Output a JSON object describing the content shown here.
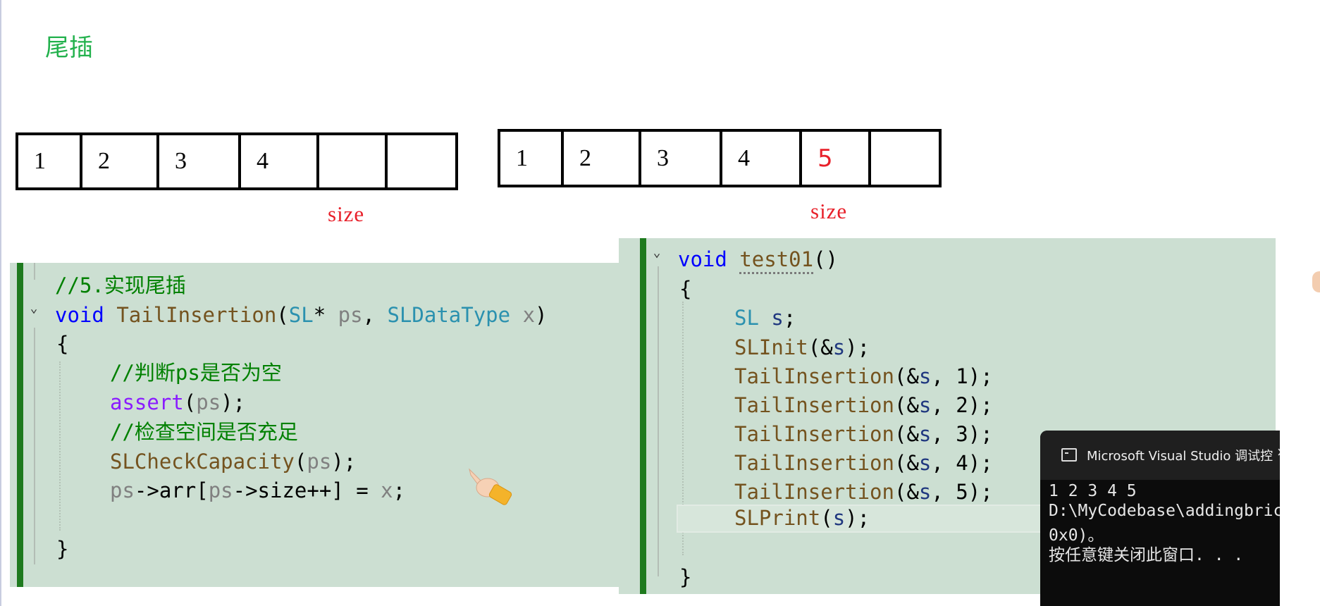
{
  "heading": "尾插",
  "array_before": {
    "cells": [
      "1",
      "2",
      "3",
      "4",
      "",
      ""
    ],
    "pointer_label": "size"
  },
  "array_after": {
    "cells": [
      "1",
      "2",
      "3",
      "4",
      "5",
      ""
    ],
    "pointer_label": "size",
    "highlight_value": "5",
    "highlight_color": "#e8202a"
  },
  "left_code": {
    "comment_top": "//5.实现尾插",
    "kw_void": "void",
    "fn_name": "TailInsertion",
    "paren_open": "(",
    "type_sl": "SL",
    "star": "*",
    "param_ps": "ps",
    "comma": ",",
    "type_dt": "SLDataType",
    "param_x": "x",
    "paren_close": ")",
    "brace_open": "{",
    "comment_check_null": "//判断ps是否为空",
    "assert_fn": "assert",
    "assert_lp": "(",
    "assert_arg": "ps",
    "assert_tail": ");",
    "comment_capacity": "//检查空间是否充足",
    "capacity_fn": "SLCheckCapacity",
    "capacity_lp": "(",
    "capacity_arg": "ps",
    "capacity_tail": ");",
    "assign_ps1": "ps",
    "assign_mid1": "->arr[",
    "assign_ps2": "ps",
    "assign_mid2": "->size++] = ",
    "assign_x": "x",
    "assign_end": ";",
    "brace_close": "}"
  },
  "right_code": {
    "kw_void": "void",
    "fn_name": "test01",
    "fn_parens": "()",
    "brace_open": "{",
    "decl_type": "SL",
    "decl_var": "s",
    "decl_end": ";",
    "init_fn": "SLInit",
    "init_lp": "(&",
    "init_var": "s",
    "init_tail": ");",
    "insert_fn": "TailInsertion",
    "insert_lp": "(&",
    "insert_var": "s",
    "insert_sep": ", ",
    "insert_values": [
      "1",
      "2",
      "3",
      "4",
      "5"
    ],
    "insert_tail": ");",
    "print_fn": "SLPrint",
    "print_lp": "(",
    "print_var": "s",
    "print_tail": ");",
    "brace_close": "}"
  },
  "console": {
    "title": "Microsoft Visual Studio 调试控",
    "close_glyph": "×",
    "lines": [
      "1 2 3 4 5",
      "D:\\MyCodebase\\addingbric",
      "0x0)。",
      "按任意键关闭此窗口. . ."
    ]
  },
  "colors": {
    "code_bg": "#ccdfd2",
    "keyword": "#0000ff",
    "function": "#74531f",
    "type": "#2b91af",
    "comment": "#008000",
    "macro": "#8a1bff",
    "heading": "#22b14c"
  },
  "icons": [
    "pointing-hand-icon",
    "fold-chevron-icon",
    "console-app-icon",
    "close-icon"
  ]
}
